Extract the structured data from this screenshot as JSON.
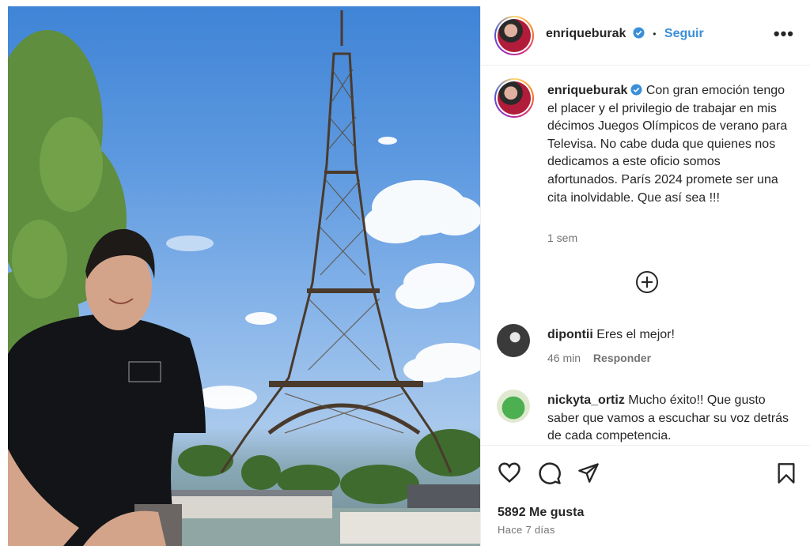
{
  "post": {
    "username": "enriqueburak",
    "follow_label": "Seguir",
    "separator": "•",
    "more_label": "•••",
    "caption": "Con gran emoción tengo el placer y el privilegio de trabajar en mis décimos Juegos Olímpicos de verano para Televisa. No cabe duda que quienes nos dedicamos a este oficio somos afortunados. París 2024 promete ser una cita inolvidable. Que así sea !!!",
    "caption_time": "1 sem"
  },
  "comments": [
    {
      "username": "dipontii",
      "text": "Eres el mejor!",
      "time": "46 min",
      "reply_label": "Responder"
    },
    {
      "username": "nickyta_ortiz",
      "text": "Mucho éxito!! Que gusto saber que vamos a escuchar su voz detrás de cada competencia."
    }
  ],
  "footer": {
    "likes": "5892 Me gusta",
    "date": "Hace 7 días"
  },
  "icons": [
    "verified-badge-icon",
    "more-options-icon",
    "load-more-comments-icon",
    "heart-icon",
    "comment-icon",
    "share-icon",
    "save-icon"
  ],
  "colors": {
    "accent": "#3a8fd8",
    "text": "#262626",
    "secondary": "#737373",
    "border": "#efefef"
  }
}
